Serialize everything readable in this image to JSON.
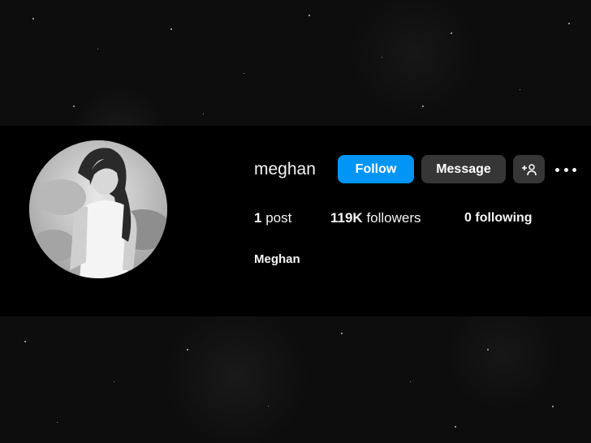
{
  "profile": {
    "username": "meghan",
    "display_name": "Meghan",
    "avatar": "profile-photo-icon"
  },
  "actions": {
    "follow_label": "Follow",
    "message_label": "Message",
    "add_user_icon": "person-plus-icon",
    "more_icon": "more-options-icon"
  },
  "stats": {
    "posts_count": "1",
    "posts_label": "post",
    "followers_count": "119K",
    "followers_label": "followers",
    "following_count": "0",
    "following_label": "following"
  },
  "colors": {
    "accent": "#0095f6",
    "button_secondary": "#363636",
    "band": "#000000",
    "text": "#f5f5f5"
  }
}
